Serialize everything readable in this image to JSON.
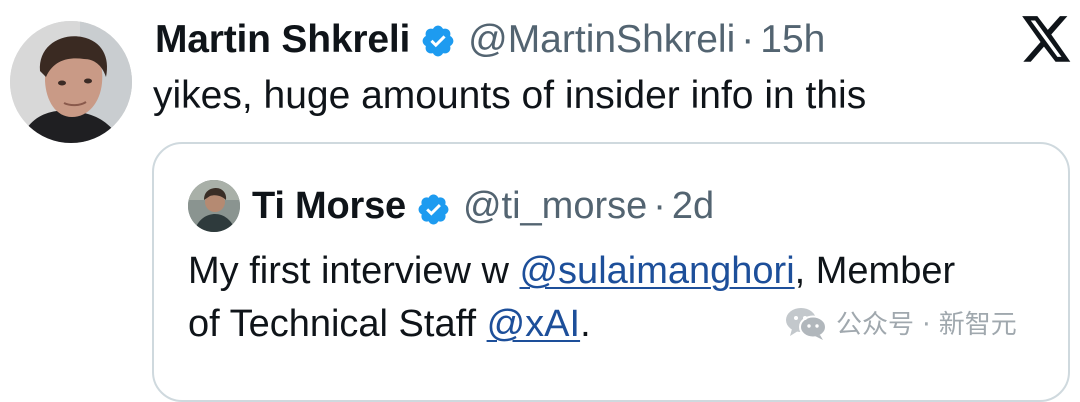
{
  "tweet": {
    "author_name": "Martin Shkreli",
    "handle": "@MartinShkreli",
    "separator": "·",
    "time": "15h",
    "text": "yikes, huge amounts of insider info in this"
  },
  "quoted_tweet": {
    "author_name": "Ti Morse",
    "handle": "@ti_morse",
    "separator": "·",
    "time": "2d",
    "text_part1": "My first interview w ",
    "mention1": "@sulaimanghori",
    "text_part2": ", Member",
    "text_part3": "of Technical Staff ",
    "mention2": "@xAI",
    "text_part4": "."
  },
  "watermark": {
    "text": "公众号 · 新智元"
  },
  "icons": {
    "verified": "verified-badge-icon",
    "logo": "x-logo-icon",
    "watermark": "wechat-icon"
  },
  "colors": {
    "text": "#0f1419",
    "muted": "#536471",
    "verified": "#1d9bf0",
    "link": "#1d4f9a",
    "border": "#cfd9de"
  }
}
